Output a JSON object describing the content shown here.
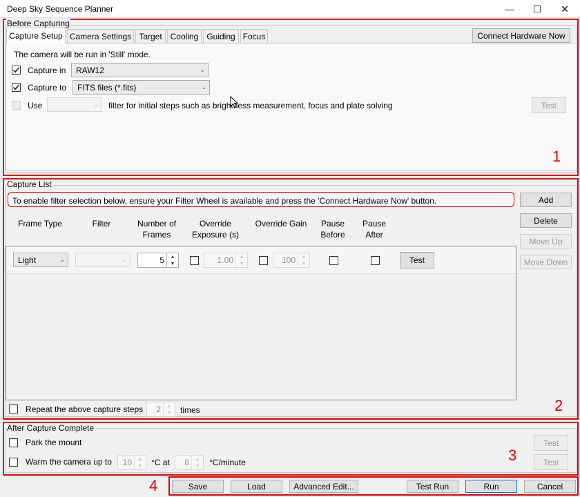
{
  "window": {
    "title": "Deep Sky Sequence Planner",
    "minimize_glyph": "—",
    "maximize_glyph": "☐",
    "close_glyph": "✕"
  },
  "colors": {
    "annotation": "#e00000",
    "accent": "#0078d7"
  },
  "before": {
    "title": "Before Capturing",
    "tabs": [
      "Capture Setup",
      "Camera Settings",
      "Target",
      "Cooling",
      "Guiding",
      "Focus"
    ],
    "active_tab": "Capture Setup",
    "connect_button": "Connect Hardware Now",
    "mode_text": "The camera will be run in 'Still' mode.",
    "capture_in": {
      "label": "Capture in",
      "value": "RAW12",
      "checked": true
    },
    "capture_to": {
      "label": "Capture to",
      "value": "FITS files (*.fits)",
      "checked": true
    },
    "use": {
      "label": "Use",
      "value": "",
      "suffix": "filter for initial steps such as brightness measurement, focus and plate solving",
      "checked": false
    },
    "test_button": "Test",
    "annotation": "1"
  },
  "capture_list": {
    "title": "Capture List",
    "notice": "To enable filter selection below, ensure your Filter Wheel is available and press the 'Connect Hardware Now' button.",
    "headers": {
      "frame_type": "Frame Type",
      "filter": "Filter",
      "number_of_frames_1": "Number of",
      "number_of_frames_2": "Frames",
      "override_exposure_1": "Override",
      "override_exposure_2": "Exposure (s)",
      "override_gain": "Override Gain",
      "pause_before_1": "Pause",
      "pause_before_2": "Before",
      "pause_after_1": "Pause",
      "pause_after_2": "After"
    },
    "row": {
      "frame_type": "Light",
      "filter": "",
      "frames": "5",
      "exposure": "1.00",
      "gain": "100",
      "test_button": "Test"
    },
    "side_buttons": {
      "add": "Add",
      "delete": "Delete",
      "move_up": "Move Up",
      "move_down": "Move Down"
    },
    "repeat": {
      "label": "Repeat the above capture steps",
      "value": "2",
      "suffix": "times"
    },
    "annotation": "2"
  },
  "after": {
    "title": "After Capture Complete",
    "park_label": "Park the mount",
    "warm_label": "Warm the camera up to",
    "warm_temp": "10",
    "c_at": "°C at",
    "rate": "8",
    "rate_unit": "°C/minute",
    "test_button_1": "Test",
    "test_button_2": "Test",
    "annotation": "3"
  },
  "footer": {
    "save": "Save",
    "load": "Load",
    "advanced": "Advanced Edit...",
    "test_run": "Test Run",
    "run": "Run",
    "cancel": "Cancel",
    "annotation": "4"
  }
}
